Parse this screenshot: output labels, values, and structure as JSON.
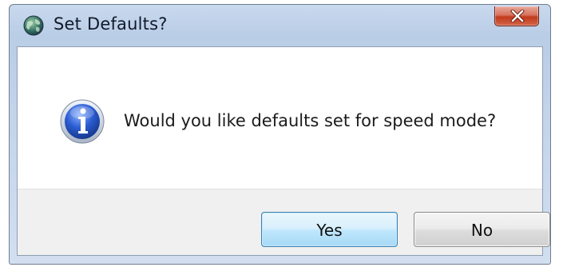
{
  "window": {
    "title": "Set Defaults?",
    "app_icon": "globe-app-icon",
    "close_icon": "close-icon"
  },
  "dialog": {
    "icon": "info-icon",
    "message": "Would you like defaults set for speed mode?"
  },
  "buttons": {
    "yes_label": "Yes",
    "no_label": "No",
    "default_button": "Yes"
  },
  "colors": {
    "title_bar": "#c2d3ea",
    "close_button": "#c2391b",
    "info_icon": "#2a5bd0",
    "default_button": "#bee6fd"
  }
}
